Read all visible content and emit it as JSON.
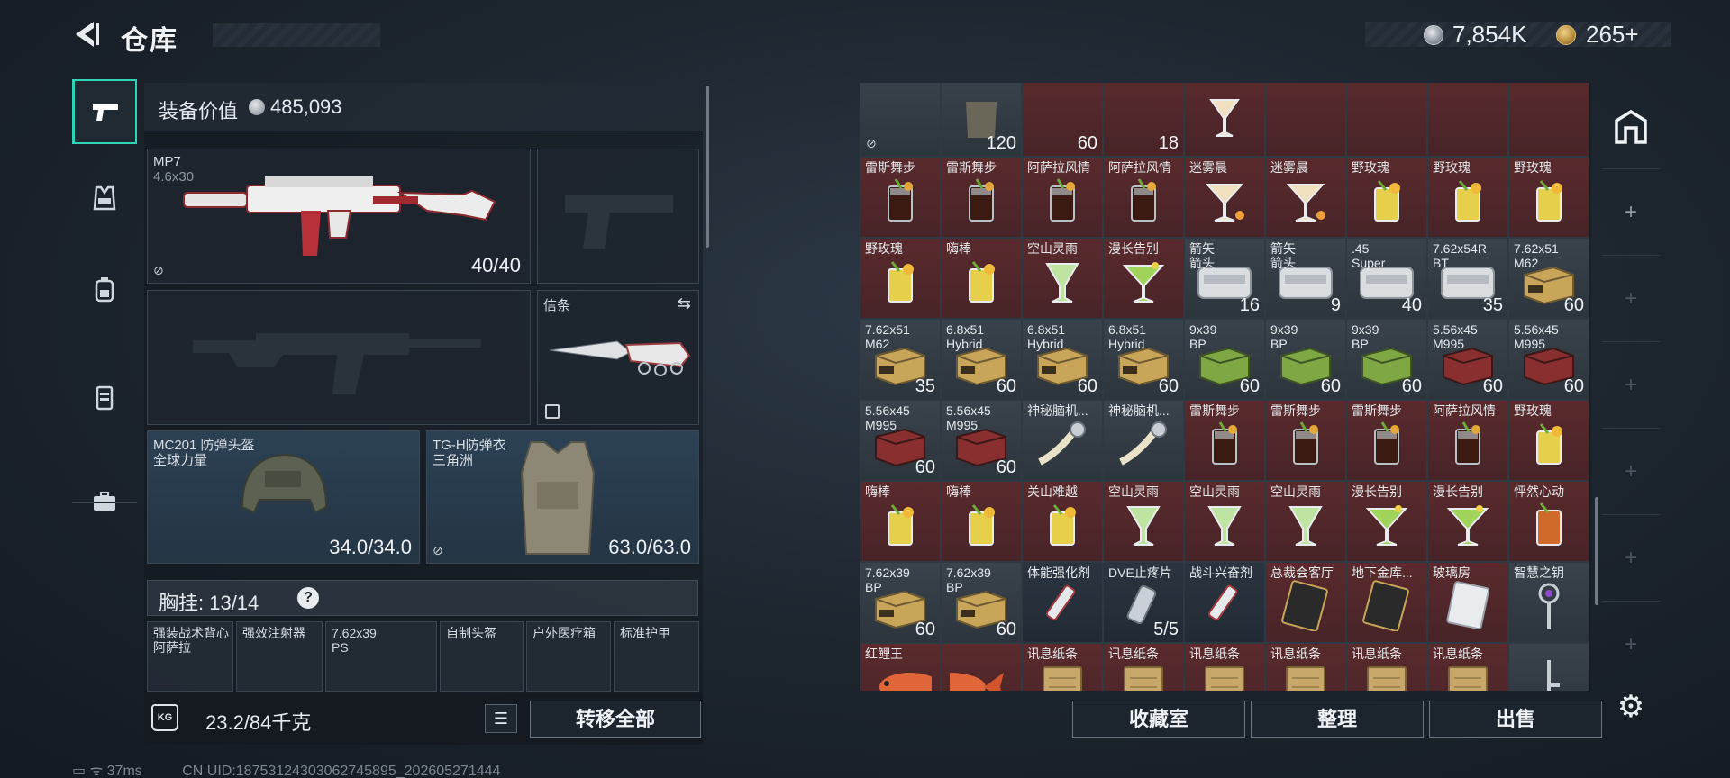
{
  "header": {
    "title": "仓库",
    "currency1": "7,854K",
    "currency2": "265+"
  },
  "equip": {
    "label": "装备价值",
    "value": "485,093"
  },
  "slots": {
    "primary": {
      "name": "MP7",
      "sub": "4.6x30",
      "ammo": "40/40"
    },
    "melee": {
      "name": "信条"
    },
    "helmet": {
      "name": "MC201 防弹头盔",
      "sub": "全球力量",
      "dur": "34.0/34.0"
    },
    "armor": {
      "name": "TG-H防弹衣",
      "sub": "三角洲",
      "dur": "63.0/63.0"
    }
  },
  "vest": {
    "label": "胸挂: 13/14",
    "help": "?",
    "slots": [
      {
        "name": "强装战术背心\n阿萨拉"
      },
      {
        "name": "强效注射器"
      },
      {
        "name": "7.62x39\nPS"
      },
      {
        "name": "自制头盔"
      },
      {
        "name": "户外医疗箱"
      },
      {
        "name": "标准护甲"
      }
    ]
  },
  "bottom": {
    "weight": "23.2/84千克",
    "weight_icon": "KG",
    "transfer": "转移全部"
  },
  "grid": [
    [
      {
        "n": "",
        "c": "",
        "t": "gray",
        "i": "none-insure"
      },
      {
        "n": "",
        "c": "120",
        "t": "gray",
        "i": "armor"
      },
      {
        "n": "",
        "c": "60",
        "t": "red",
        "i": "none"
      },
      {
        "n": "",
        "c": "18",
        "t": "red",
        "i": "none"
      },
      {
        "n": "",
        "c": "",
        "t": "red",
        "i": "cocktail"
      },
      {
        "n": "",
        "c": "",
        "t": "red",
        "i": "none"
      },
      {
        "n": "",
        "c": "",
        "t": "red",
        "i": "none"
      },
      {
        "n": "",
        "c": "",
        "t": "red",
        "i": "none"
      },
      {
        "n": "",
        "c": "",
        "t": "red",
        "i": "none"
      }
    ],
    [
      {
        "n": "雷斯舞步",
        "c": "",
        "t": "red",
        "i": "cola"
      },
      {
        "n": "雷斯舞步",
        "c": "",
        "t": "red",
        "i": "cola"
      },
      {
        "n": "阿萨拉风情",
        "c": "",
        "t": "red",
        "i": "cola"
      },
      {
        "n": "阿萨拉风情",
        "c": "",
        "t": "red",
        "i": "cola"
      },
      {
        "n": "迷雾晨",
        "c": "",
        "t": "red",
        "i": "martini"
      },
      {
        "n": "迷雾晨",
        "c": "",
        "t": "red",
        "i": "martini"
      },
      {
        "n": "野玫瑰",
        "c": "",
        "t": "red",
        "i": "yellow"
      },
      {
        "n": "野玫瑰",
        "c": "",
        "t": "red",
        "i": "yellow"
      },
      {
        "n": "野玫瑰",
        "c": "",
        "t": "red",
        "i": "yellow"
      }
    ],
    [
      {
        "n": "野玫瑰",
        "c": "",
        "t": "red",
        "i": "yellow"
      },
      {
        "n": "嗨棒",
        "c": "",
        "t": "red",
        "i": "yellow"
      },
      {
        "n": "空山灵雨",
        "c": "",
        "t": "red",
        "i": "green"
      },
      {
        "n": "漫长告别",
        "c": "",
        "t": "red",
        "i": "greenmartini"
      },
      {
        "n": "箭矢\n箭头",
        "c": "16",
        "t": "gray",
        "i": "tin"
      },
      {
        "n": "箭矢\n箭头",
        "c": "9",
        "t": "gray",
        "i": "tin"
      },
      {
        "n": ".45\nSuper",
        "c": "40",
        "t": "gray",
        "i": "tin"
      },
      {
        "n": "7.62x54R\nBT",
        "c": "35",
        "t": "gray",
        "i": "tin"
      },
      {
        "n": "7.62x51\nM62",
        "c": "60",
        "t": "gray",
        "i": "ammo"
      }
    ],
    [
      {
        "n": "7.62x51\nM62",
        "c": "35",
        "t": "gray",
        "i": "ammo"
      },
      {
        "n": "6.8x51\nHybrid",
        "c": "60",
        "t": "gray",
        "i": "ammo"
      },
      {
        "n": "6.8x51\nHybrid",
        "c": "60",
        "t": "gray",
        "i": "ammo"
      },
      {
        "n": "6.8x51\nHybrid",
        "c": "60",
        "t": "gray",
        "i": "ammo"
      },
      {
        "n": "9x39\nBP",
        "c": "60",
        "t": "gray",
        "i": "greenbox"
      },
      {
        "n": "9x39\nBP",
        "c": "60",
        "t": "gray",
        "i": "greenbox"
      },
      {
        "n": "9x39\nBP",
        "c": "60",
        "t": "gray",
        "i": "greenbox"
      },
      {
        "n": "5.56x45\nM995",
        "c": "60",
        "t": "gray",
        "i": "redbox"
      },
      {
        "n": "5.56x45\nM995",
        "c": "60",
        "t": "gray",
        "i": "redbox"
      }
    ],
    [
      {
        "n": "5.56x45\nM995",
        "c": "60",
        "t": "gray",
        "i": "redbox"
      },
      {
        "n": "5.56x45\nM995",
        "c": "60",
        "t": "gray",
        "i": "redbox"
      },
      {
        "n": "神秘脑机...",
        "c": "",
        "t": "gray",
        "i": "device"
      },
      {
        "n": "神秘脑机...",
        "c": "",
        "t": "gray",
        "i": "device"
      },
      {
        "n": "雷斯舞步",
        "c": "",
        "t": "red",
        "i": "cola"
      },
      {
        "n": "雷斯舞步",
        "c": "",
        "t": "red",
        "i": "cola"
      },
      {
        "n": "雷斯舞步",
        "c": "",
        "t": "red",
        "i": "cola"
      },
      {
        "n": "阿萨拉风情",
        "c": "",
        "t": "red",
        "i": "cola"
      },
      {
        "n": "野玫瑰",
        "c": "",
        "t": "red",
        "i": "yellow"
      }
    ],
    [
      {
        "n": "嗨棒",
        "c": "",
        "t": "red",
        "i": "yellow"
      },
      {
        "n": "嗨棒",
        "c": "",
        "t": "red",
        "i": "yellow"
      },
      {
        "n": "关山难越",
        "c": "",
        "t": "red",
        "i": "yellow"
      },
      {
        "n": "空山灵雨",
        "c": "",
        "t": "red",
        "i": "green"
      },
      {
        "n": "空山灵雨",
        "c": "",
        "t": "red",
        "i": "green"
      },
      {
        "n": "空山灵雨",
        "c": "",
        "t": "red",
        "i": "green"
      },
      {
        "n": "漫长告别",
        "c": "",
        "t": "red",
        "i": "greenmartini"
      },
      {
        "n": "漫长告别",
        "c": "",
        "t": "red",
        "i": "greenmartini"
      },
      {
        "n": "怦然心动",
        "c": "",
        "t": "red",
        "i": "orange"
      }
    ],
    [
      {
        "n": "7.62x39\nBP",
        "c": "60",
        "t": "gray",
        "i": "ammo"
      },
      {
        "n": "7.62x39\nBP",
        "c": "60",
        "t": "gray",
        "i": "ammo"
      },
      {
        "n": "体能强化剂",
        "c": "",
        "t": "dark",
        "i": "syringe"
      },
      {
        "n": "DVE止疼片",
        "c": "5/5",
        "t": "dark",
        "i": "pills"
      },
      {
        "n": "战斗兴奋剂",
        "c": "",
        "t": "dark",
        "i": "syringe"
      },
      {
        "n": "总裁会客厅",
        "c": "",
        "t": "red",
        "i": "card"
      },
      {
        "n": "地下金库...",
        "c": "",
        "t": "red",
        "i": "card"
      },
      {
        "n": "玻璃房",
        "c": "",
        "t": "red",
        "i": "whitecard"
      },
      {
        "n": "智慧之钥",
        "c": "",
        "t": "gray",
        "i": "key"
      }
    ],
    [
      {
        "n": "红鲤王",
        "c": "",
        "t": "red",
        "i": "fish"
      },
      {
        "n": "",
        "c": "",
        "t": "red",
        "i": "fishtail"
      },
      {
        "n": "讯息纸条",
        "c": "",
        "t": "red",
        "i": "paper"
      },
      {
        "n": "讯息纸条",
        "c": "",
        "t": "red",
        "i": "paper"
      },
      {
        "n": "讯息纸条",
        "c": "",
        "t": "red",
        "i": "paper"
      },
      {
        "n": "讯息纸条",
        "c": "",
        "t": "red",
        "i": "paper"
      },
      {
        "n": "讯息纸条",
        "c": "",
        "t": "red",
        "i": "paper"
      },
      {
        "n": "讯息纸条",
        "c": "",
        "t": "red",
        "i": "paper"
      },
      {
        "n": "",
        "c": "",
        "t": "gray",
        "i": "keytail"
      }
    ]
  ],
  "buttons": {
    "collection": "收藏室",
    "sort": "整理",
    "sell": "出售"
  },
  "status": {
    "ping": "37ms",
    "uid": "CN UID:18753124303062745895_202605271444"
  }
}
